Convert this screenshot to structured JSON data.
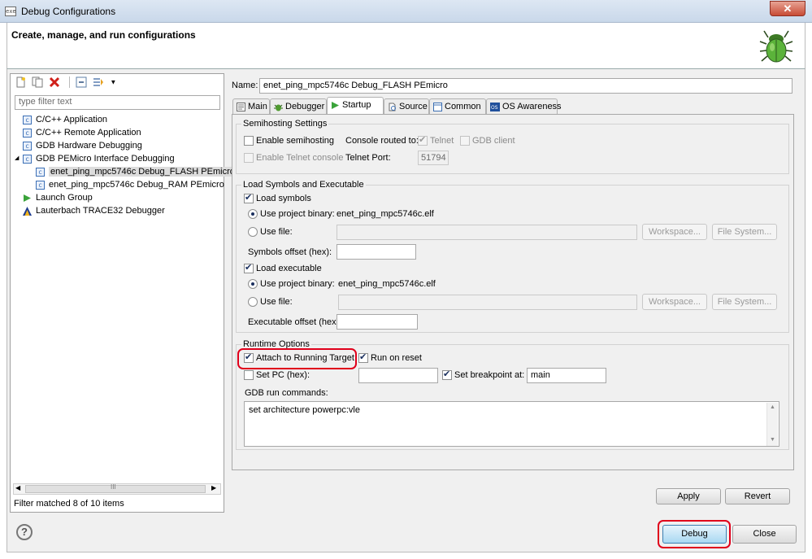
{
  "window": {
    "title": "Debug Configurations",
    "app_icon_text": "exe"
  },
  "header": {
    "title": "Create, manage, and run configurations",
    "icon": "bug-icon"
  },
  "toolbar": {
    "icons": [
      "new-config-icon",
      "duplicate-icon",
      "delete-icon",
      "collapse-all-icon",
      "filter-icon"
    ]
  },
  "filter": {
    "placeholder": "type filter text"
  },
  "tree": {
    "items": [
      {
        "label": "C/C++ Application",
        "icon": "c-icon",
        "level": 0
      },
      {
        "label": "C/C++ Remote Application",
        "icon": "c-icon",
        "level": 0
      },
      {
        "label": "GDB Hardware Debugging",
        "icon": "c-icon",
        "level": 0
      },
      {
        "label": "GDB PEMicro Interface Debugging",
        "icon": "c-icon",
        "level": 0,
        "expanded": true
      },
      {
        "label": "enet_ping_mpc5746c Debug_FLASH PEmicro",
        "icon": "c-icon",
        "level": 1,
        "selected": true
      },
      {
        "label": "enet_ping_mpc5746c Debug_RAM PEmicro",
        "icon": "c-icon",
        "level": 1
      },
      {
        "label": "Launch Group",
        "icon": "launch-icon",
        "level": 0
      },
      {
        "label": "Lauterbach TRACE32 Debugger",
        "icon": "trace32-icon",
        "level": 0
      }
    ],
    "scroll_grip": "III",
    "status": "Filter matched 8 of 10 items"
  },
  "config": {
    "name_label": "Name:",
    "name_value": "enet_ping_mpc5746c Debug_FLASH PEmicro",
    "tabs": [
      "Main",
      "Debugger",
      "Startup",
      "Source",
      "Common",
      "OS Awareness"
    ],
    "active_tab": "Startup"
  },
  "semihosting": {
    "title": "Semihosting Settings",
    "enable_semihosting": "Enable semihosting",
    "enable_telnet": "Enable Telnet console",
    "console_routed": "Console routed to:",
    "telnet": "Telnet",
    "gdb_client": "GDB client",
    "telnet_port_label": "Telnet Port:",
    "telnet_port": "51794"
  },
  "load": {
    "title": "Load Symbols and Executable",
    "load_symbols": "Load symbols",
    "use_project_binary": "Use project binary:",
    "binary": "enet_ping_mpc5746c.elf",
    "use_file": "Use file:",
    "workspace": "Workspace...",
    "file_system": "File System...",
    "symbols_offset": "Symbols offset (hex):",
    "load_executable": "Load executable",
    "executable_offset": "Executable offset (hex):"
  },
  "runtime": {
    "title": "Runtime Options",
    "attach": "Attach to Running Target",
    "run_on_reset": "Run on reset",
    "set_pc": "Set PC (hex):",
    "set_breakpoint": "Set breakpoint at:",
    "breakpoint_value": "main",
    "gdb_cmds_label": "GDB run commands:",
    "gdb_cmds": "set architecture powerpc:vle"
  },
  "buttons": {
    "apply": "Apply",
    "revert": "Revert",
    "debug": "Debug",
    "close": "Close",
    "help": "?"
  }
}
